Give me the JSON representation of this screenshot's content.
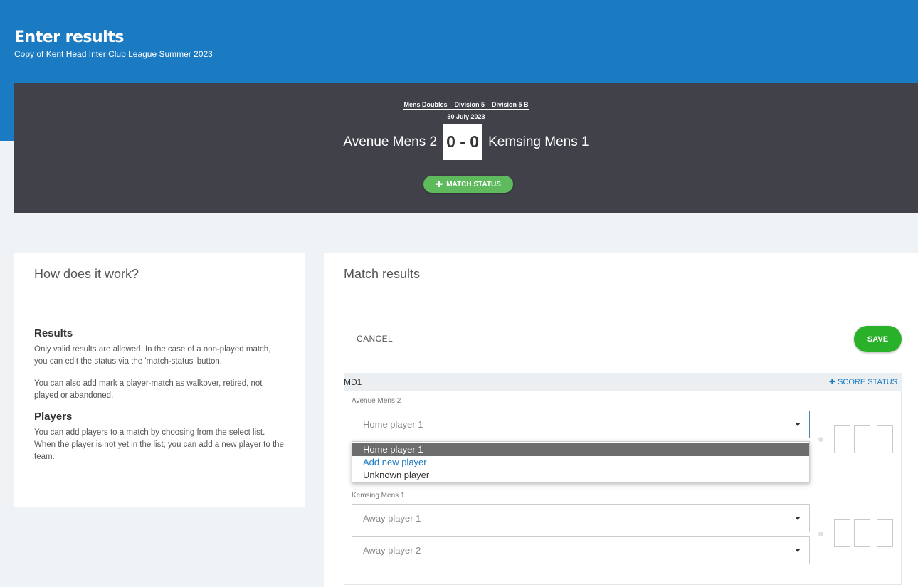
{
  "page": {
    "title": "Enter results",
    "subtitle": "Copy of Kent Head Inter Club League Summer 2023"
  },
  "match": {
    "division": "Mens Doubles – Division 5 – Division 5 B",
    "date": "30 July 2023",
    "home_team": "Avenue Mens 2",
    "away_team": "Kemsing Mens 1",
    "score": "0 - 0",
    "status_button": "MATCH STATUS"
  },
  "help": {
    "title": "How does it work?",
    "results_heading": "Results",
    "results_p1": "Only valid results are allowed. In the case of a non-played match, you can edit the status via the 'match-status' button.",
    "results_p2": "You can also add mark a player-match as walkover, retired, not played or abandoned.",
    "players_heading": "Players",
    "players_p1": "You can add players to a match by choosing from the select list. When the player is not yet in the list, you can add a new player to the team."
  },
  "results": {
    "title": "Match results",
    "cancel_label": "CANCEL",
    "save_label": "SAVE",
    "md_label": "MD1",
    "score_status_label": "SCORE STATUS",
    "home_team_label": "Avenue Mens 2",
    "away_team_label": "Kemsing Mens 1",
    "home_player1_value": "Home player 1",
    "away_player1_value": "Away player 1",
    "away_player2_value": "Away player 2",
    "dropdown_options": [
      "Home player 1",
      "Add new player",
      "Unknown player"
    ]
  },
  "colors": {
    "brand_blue": "#1a7ac2",
    "header_dark": "#404149",
    "save_green": "#2ab12a",
    "status_green": "#5fba5e"
  },
  "icons": [
    "plus-icon",
    "chevron-down-icon"
  ]
}
